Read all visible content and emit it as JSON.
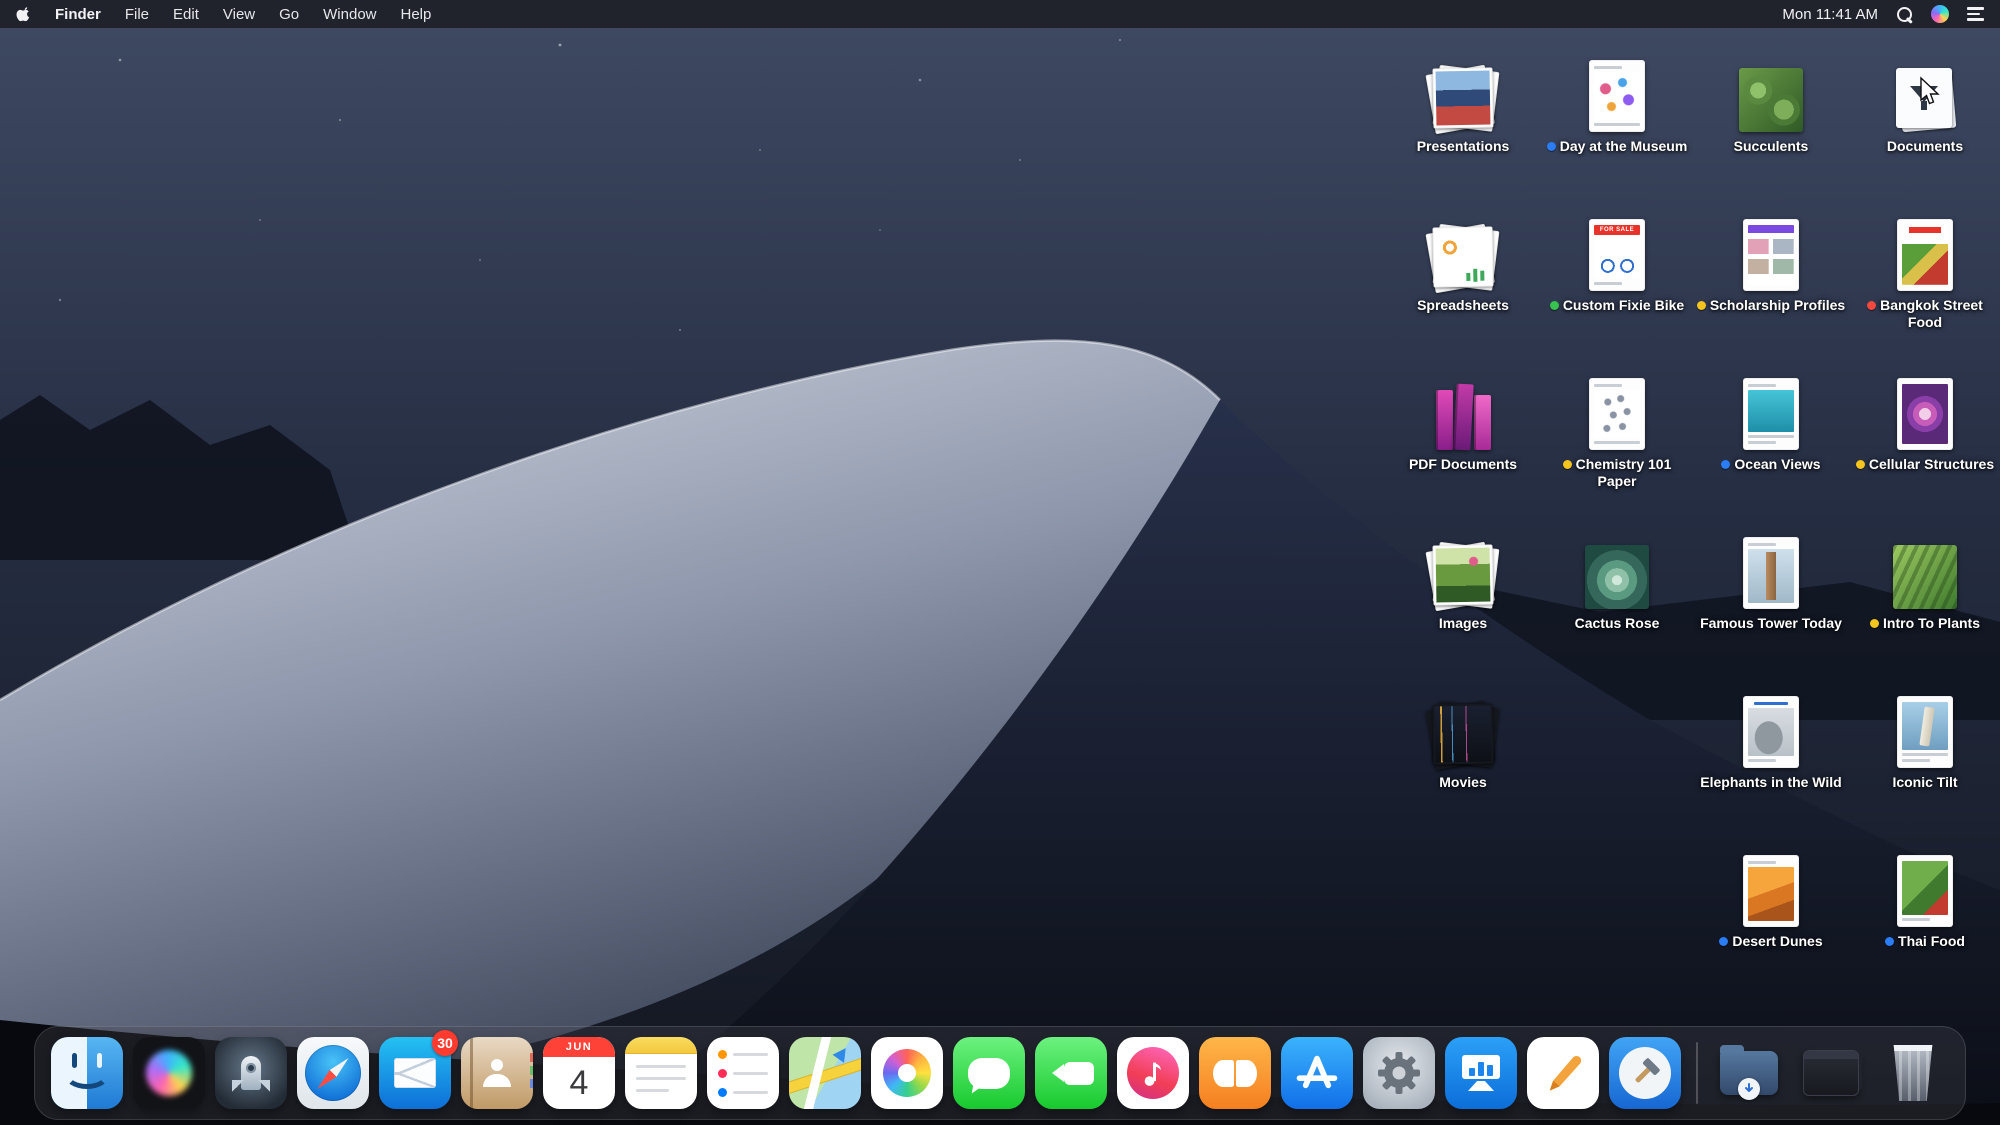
{
  "menu_bar": {
    "app_name": "Finder",
    "menus": [
      "File",
      "Edit",
      "View",
      "Go",
      "Window",
      "Help"
    ],
    "status": {
      "clock": "Mon 11:41 AM"
    },
    "icons": [
      "apple-logo",
      "spotlight-search",
      "siri",
      "notification-center"
    ]
  },
  "desktop": {
    "fixie_banner": "FOR SALE",
    "tag_colors": {
      "blue": "#2a7cf7",
      "green": "#37c24f",
      "yellow": "#f5c51f",
      "red": "#f5493f"
    },
    "items": [
      {
        "label": "Presentations",
        "tag": null,
        "type": "photo-stack"
      },
      {
        "label": "Day at the Museum",
        "tag": "blue",
        "type": "document"
      },
      {
        "label": "Succulents",
        "tag": null,
        "type": "image"
      },
      {
        "label": "Documents",
        "tag": null,
        "type": "stack"
      },
      {
        "label": "Spreadsheets",
        "tag": null,
        "type": "document-stack"
      },
      {
        "label": "Custom Fixie Bike",
        "tag": "green",
        "type": "document"
      },
      {
        "label": "Scholarship Profiles",
        "tag": "yellow",
        "type": "document"
      },
      {
        "label": "Bangkok Street Food",
        "tag": "red",
        "type": "document"
      },
      {
        "label": "PDF Documents",
        "tag": null,
        "type": "book-stack"
      },
      {
        "label": "Chemistry 101 Paper",
        "tag": "yellow",
        "type": "document"
      },
      {
        "label": "Ocean Views",
        "tag": "blue",
        "type": "document"
      },
      {
        "label": "Cellular Structures",
        "tag": "yellow",
        "type": "document"
      },
      {
        "label": "Images",
        "tag": null,
        "type": "photo-stack"
      },
      {
        "label": "Cactus Rose",
        "tag": null,
        "type": "image"
      },
      {
        "label": "Famous Tower Today",
        "tag": null,
        "type": "document"
      },
      {
        "label": "Intro To Plants",
        "tag": "yellow",
        "type": "image"
      },
      {
        "label": "Movies",
        "tag": null,
        "type": "video-stack"
      },
      {
        "label": "Elephants in the Wild",
        "tag": null,
        "type": "document"
      },
      {
        "label": "Iconic Tilt",
        "tag": null,
        "type": "document"
      },
      {
        "label": "Desert Dunes",
        "tag": "blue",
        "type": "image"
      },
      {
        "label": "Thai Food",
        "tag": "blue",
        "type": "document"
      }
    ]
  },
  "dock": {
    "apps": [
      "finder",
      "siri",
      "launchpad",
      "safari",
      "mail",
      "contacts",
      "calendar",
      "notes",
      "reminders",
      "maps",
      "photos",
      "messages",
      "facetime",
      "itunes",
      "books",
      "app-store",
      "system-preferences",
      "keynote",
      "pages",
      "xcode",
      "downloads-folder",
      "dark-stack",
      "trash"
    ],
    "mail_badge": "30",
    "calendar": {
      "month": "JUN",
      "day": "4"
    }
  }
}
